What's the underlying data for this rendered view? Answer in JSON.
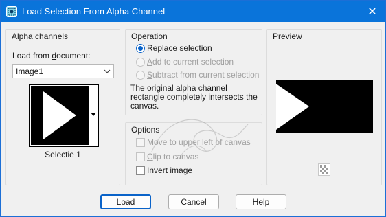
{
  "window": {
    "title": "Load Selection From Alpha Channel",
    "icon": "selection-icon",
    "close_label": "✕"
  },
  "alpha": {
    "group_title": "Alpha channels",
    "load_from_label_pre": "Load from ",
    "load_from_label_u": "d",
    "load_from_label_post": "ocument:",
    "document_value": "Image1",
    "channel_name": "Selectie 1"
  },
  "operation": {
    "group_title": "Operation",
    "replace_u": "R",
    "replace_rest": "eplace selection",
    "add_u": "A",
    "add_rest": "dd to current selection",
    "subtract_u": "S",
    "subtract_rest": "ubtract from current selection",
    "description": "The original alpha channel rectangle completely intersects the canvas."
  },
  "options": {
    "group_title": "Options",
    "move_u": "M",
    "move_rest": "ove to upper left of canvas",
    "clip_u": "C",
    "clip_rest": "lip to canvas",
    "invert_u": "I",
    "invert_rest": "nvert image"
  },
  "preview": {
    "group_title": "Preview"
  },
  "buttons": {
    "load": "Load",
    "cancel": "Cancel",
    "help": "Help"
  },
  "colors": {
    "titlebar": "#0a74da",
    "accent": "#0a63c9"
  }
}
